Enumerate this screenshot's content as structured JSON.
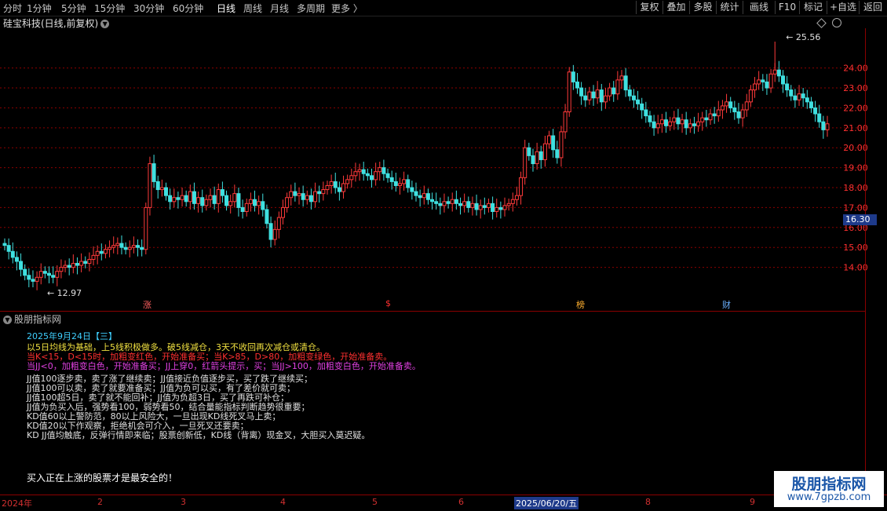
{
  "toolbar": {
    "periods": [
      "分时",
      "1分钟",
      "5分钟",
      "15分钟",
      "30分钟",
      "60分钟",
      "日线",
      "周线",
      "月线",
      "多周期",
      "更多 〉"
    ],
    "active_period": "日线",
    "buttons": [
      "复权",
      "叠加",
      "多股",
      "统计",
      "画线",
      "F10",
      "标记",
      "+自选",
      "返回"
    ]
  },
  "stock": {
    "title": "硅宝科技(日线,前复权)"
  },
  "price_axis": {
    "labels": [
      "24.00",
      "23.00",
      "22.00",
      "21.00",
      "20.00",
      "19.00",
      "18.00",
      "17.00",
      "16.00",
      "15.00",
      "14.00"
    ],
    "current": "16.30"
  },
  "annotations": {
    "high": "25.56",
    "low": "12.97"
  },
  "markers": [
    {
      "text": "涨",
      "color": "#ff6060"
    },
    {
      "text": "$",
      "color": "#ff3030"
    },
    {
      "text": "榜",
      "color": "#ffb030"
    },
    {
      "text": "财",
      "color": "#6ab0ff"
    }
  ],
  "indicator": {
    "title": "股朋指标网",
    "date": "2025年9月24日【三】",
    "lines": [
      {
        "text": "以5日均线为基础，上5线积极做多。破5线减仓，3天不收回再次减仓或清仓。",
        "color": "#f0e040"
      },
      {
        "text": "当K<15，D<15时，加粗变红色，开始准备买；当K>85，D>80，加粗变绿色，开始准备卖。",
        "color": "#ff3030"
      },
      {
        "text": "当JJ<0，加粗变白色，开始准备买；JJ上穿0，红箭头提示，买；当JJ>100，加粗变白色，开始准备卖。",
        "color": "#e040e0"
      },
      {
        "text": "JJ值100逐步卖，卖了涨了继续卖；JJ值接近负值逐步买，买了跌了继续买；",
        "color": "#e0e0e0"
      },
      {
        "text": "JJ值100可以卖，卖了就要准备买；JJ值为负可以买，有了差价就可卖；",
        "color": "#e0e0e0"
      },
      {
        "text": "JJ值100超5日，卖了就不能回补；JJ值为负超3日，买了再跌可补仓；",
        "color": "#e0e0e0"
      },
      {
        "text": "JJ值为负买入后，强势看100，弱势看50，结合量能指标判断趋势很重要；",
        "color": "#e0e0e0"
      },
      {
        "text": "KD值60以上警防范，80以上风险大，一旦出现KD线死叉马上卖；",
        "color": "#e0e0e0"
      },
      {
        "text": "KD值20以下作观察，拒绝机会可介入，一旦死叉还要卖；",
        "color": "#e0e0e0"
      },
      {
        "text": "KD JJ值均触底，反弹行情即来临；股票创新低，KD线（背离）现金叉，大胆买入莫迟疑。",
        "color": "#e0e0e0"
      }
    ],
    "footer": "买入正在上涨的股票才是最安全的！"
  },
  "xaxis": {
    "labels": [
      "2024年",
      "2",
      "3",
      "4",
      "5",
      "6",
      "2025/06/20/五",
      "8",
      "9"
    ],
    "highlight": "2025/06/20/五"
  },
  "watermark": {
    "name": "股朋指标网",
    "url": "www.7gpzb.com"
  },
  "colors": {
    "up": "#ff3a3a",
    "down": "#3fe0e0",
    "grid": "#8b0000",
    "axis_text": "#ff3030"
  },
  "chart_data": {
    "type": "candlestick",
    "title": "硅宝科技(日线,前复权)",
    "ylim": [
      13,
      25.6
    ],
    "high_label": 25.56,
    "low_label": 12.97,
    "current_price": 16.3,
    "closes": [
      15.1,
      14.8,
      14.5,
      14.3,
      13.9,
      13.6,
      13.4,
      13.3,
      13.5,
      13.8,
      13.7,
      13.6,
      13.5,
      13.8,
      14.0,
      14.1,
      14.0,
      14.2,
      14.1,
      14.3,
      14.2,
      14.4,
      14.6,
      14.8,
      14.7,
      14.9,
      15.0,
      15.1,
      15.2,
      15.0,
      14.9,
      15.0,
      15.1,
      15.0,
      14.9,
      17.0,
      19.2,
      18.3,
      17.9,
      18.0,
      17.6,
      17.3,
      17.5,
      17.4,
      17.6,
      17.3,
      17.8,
      17.2,
      17.5,
      17.1,
      17.4,
      17.6,
      17.2,
      17.9,
      17.6,
      17.1,
      17.3,
      17.7,
      17.0,
      16.8,
      17.2,
      17.4,
      17.1,
      17.3,
      16.9,
      16.2,
      15.4,
      15.9,
      16.5,
      17.0,
      17.5,
      17.8,
      17.6,
      17.7,
      17.4,
      17.6,
      17.3,
      17.8,
      17.7,
      17.9,
      18.1,
      18.3,
      18.0,
      17.8,
      18.2,
      18.4,
      18.6,
      18.8,
      18.9,
      18.7,
      18.6,
      18.4,
      18.8,
      19.0,
      18.7,
      18.5,
      18.3,
      18.1,
      18.2,
      18.4,
      18.0,
      17.8,
      17.6,
      17.5,
      17.7,
      17.4,
      17.3,
      17.2,
      17.1,
      17.3,
      17.2,
      17.4,
      17.2,
      17.1,
      17.3,
      17.0,
      17.2,
      16.9,
      17.1,
      17.0,
      17.2,
      16.8,
      17.0,
      16.9,
      17.1,
      17.2,
      17.4,
      17.6,
      18.5,
      20.0,
      19.6,
      19.2,
      19.8,
      19.4,
      20.2,
      20.6,
      19.9,
      19.5,
      20.8,
      21.8,
      23.8,
      23.3,
      23.0,
      22.6,
      22.4,
      22.8,
      22.5,
      22.9,
      22.3,
      22.6,
      23.0,
      22.7,
      23.4,
      23.6,
      22.9,
      22.6,
      22.4,
      22.2,
      21.9,
      21.6,
      21.3,
      21.0,
      21.2,
      21.4,
      21.1,
      21.3,
      21.5,
      21.2,
      21.4,
      21.0,
      21.2,
      21.1,
      21.3,
      21.5,
      21.4,
      21.7,
      21.6,
      21.9,
      22.1,
      22.3,
      22.0,
      21.8,
      21.5,
      21.9,
      22.3,
      22.9,
      23.2,
      23.4,
      23.3,
      23.0,
      23.7,
      23.9,
      23.6,
      23.2,
      22.9,
      22.6,
      22.4,
      22.7,
      22.5,
      22.3,
      22.0,
      21.7,
      21.3,
      20.9,
      21.2
    ]
  }
}
